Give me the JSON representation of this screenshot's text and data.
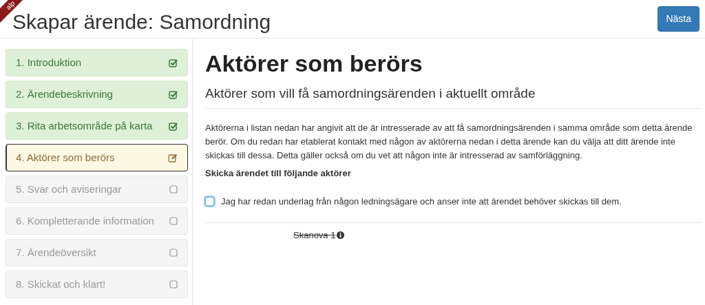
{
  "ribbon": "alp",
  "title": "Skapar ärende: Samordning",
  "next_button": "Nästa",
  "steps": [
    {
      "label": "1. Introduktion",
      "kind": "done",
      "selected": false
    },
    {
      "label": "2. Ärendebeskrivning",
      "kind": "done",
      "selected": false
    },
    {
      "label": "3. Rita arbetsområde på karta",
      "kind": "done",
      "selected": false
    },
    {
      "label": "4. Aktörer som berörs",
      "kind": "current",
      "selected": true
    },
    {
      "label": "5. Svar och aviseringar",
      "kind": "pending",
      "selected": false
    },
    {
      "label": "6. Kompletterande information",
      "kind": "pending",
      "selected": false
    },
    {
      "label": "7. Ärendeöversikt",
      "kind": "pending",
      "selected": false
    },
    {
      "label": "8. Skickat och klart!",
      "kind": "pending",
      "selected": false
    }
  ],
  "heading": "Aktörer som berörs",
  "subheading": "Aktörer som vill få samordningsärenden i aktuellt område",
  "description": "Aktörerna i listan nedan har angivit att de är intresserade av att få samordningsärenden i samma område som detta ärende berör. Om du redan har etablerat kontakt med någon av aktörerna nedan i detta ärende kan du välja att ditt ärende inte skickas till dessa. Detta gäller också om du vet att någon inte är intresserad av samförläggning.",
  "section_label": "Skicka ärendet till följande aktörer",
  "opt_out": {
    "label": "Jag har redan underlag från någon ledningsägare och anser inte att ärendet behöver skickas till dem.",
    "checked": false
  },
  "actors": [
    {
      "name": "Skanova 1",
      "struck": true
    }
  ]
}
